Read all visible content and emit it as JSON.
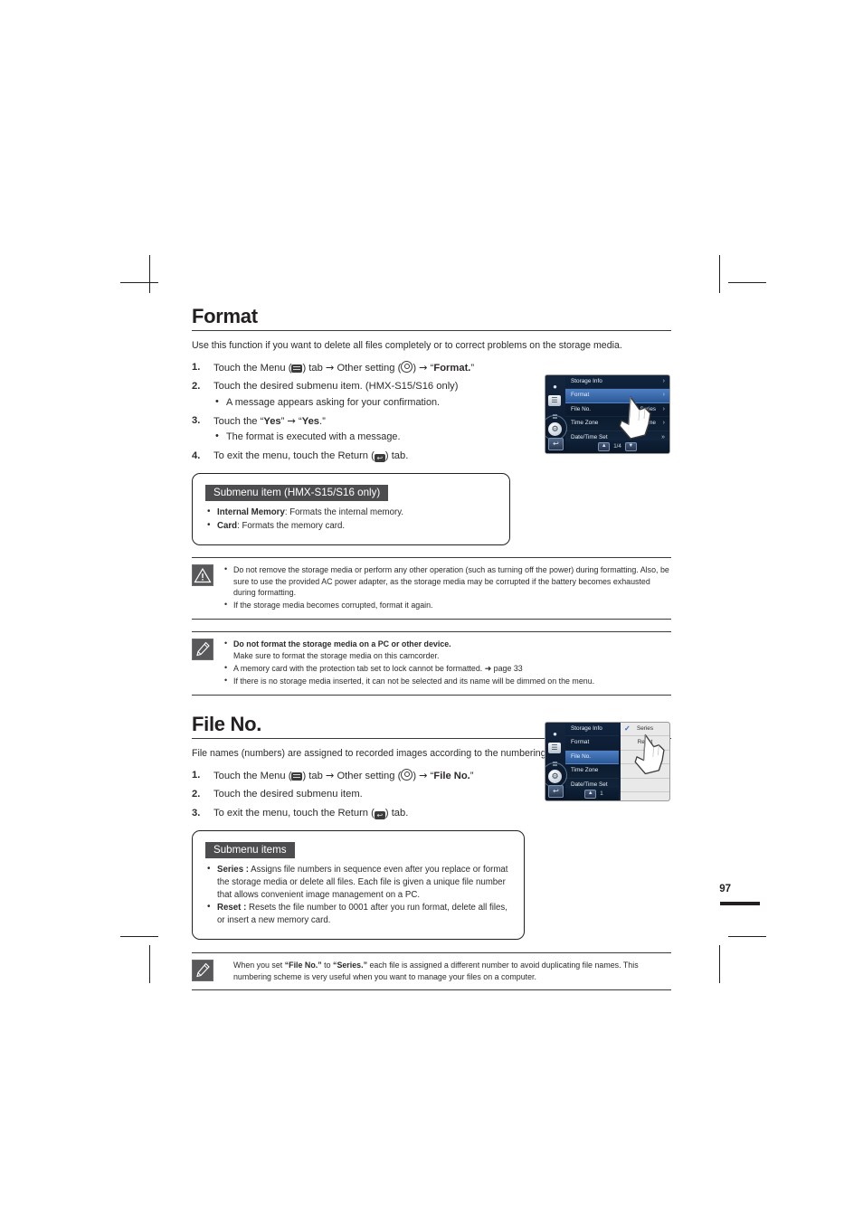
{
  "page": {
    "number": "97"
  },
  "format_section": {
    "title": "Format",
    "lead": "Use this function if you want to delete all files completely or to correct problems on the storage media.",
    "steps": [
      {
        "num": "1.",
        "parts_before": "Touch the Menu (",
        "parts_mid": ") tab",
        "arrow": "→",
        "other_setting": "Other setting (",
        "other_setting_close": ")",
        "target": "Format.",
        "quote_open": "“",
        "quote_close": "”"
      },
      {
        "num": "2.",
        "text": "Touch the desired submenu item. (HMX-S15/S16 only)",
        "bullets": [
          "A message appears asking for your confirmation."
        ]
      },
      {
        "num": "3.",
        "text_pre": "Touch the ",
        "yes1": "Yes",
        "yes2": "Yes",
        "bullets": [
          "The format is executed with a message."
        ]
      },
      {
        "num": "4.",
        "text_pre": "To exit the menu, touch the Return (",
        "text_post": ") tab."
      }
    ],
    "submenu_box": {
      "heading": "Submenu item (HMX-S15/S16 only)",
      "items": [
        {
          "term": "Internal Memory",
          "desc": ": Formats the internal memory."
        },
        {
          "term": "Card",
          "desc": ": Formats the memory card."
        }
      ]
    },
    "warning_note": {
      "icon": "warning-triangle-icon",
      "items": [
        "Do not remove the storage media or perform any other operation (such as turning off the power) during formatting. Also, be sure to use the provided AC power adapter, as the storage media may be corrupted if the battery becomes exhausted during formatting.",
        "If the storage media becomes corrupted, format it again."
      ]
    },
    "info_note": {
      "icon": "note-pen-icon",
      "items": [
        {
          "bold": "Do not format the storage media on a PC or other device.",
          "rest": "Make sure to format the storage media on this camcorder."
        },
        {
          "bold": "",
          "rest": "A memory card with the protection tab set to lock cannot be formatted. ➜ page 33"
        },
        {
          "bold": "",
          "rest": "If there is no storage media inserted, it can not be selected and its name will be dimmed on the menu."
        }
      ]
    }
  },
  "fileno_section": {
    "title": "File No.",
    "lead": "File names (numbers) are assigned to recorded images according to the numbering option you select.",
    "steps": [
      {
        "num": "1.",
        "parts_before": "Touch the Menu (",
        "parts_mid": ") tab",
        "arrow": "→",
        "other_setting": "Other setting (",
        "other_setting_close": ")",
        "target": "File No."
      },
      {
        "num": "2.",
        "text": "Touch the desired submenu item."
      },
      {
        "num": "3.",
        "text_pre": "To exit the menu, touch the Return (",
        "text_post": ") tab."
      }
    ],
    "submenu_box": {
      "heading": "Submenu items",
      "items": [
        {
          "term": "Series :",
          "desc": " Assigns file numbers in sequence even after you replace or format the storage media or delete all files. Each file is given a unique file number that allows convenient image management on a PC."
        },
        {
          "term": "Reset :",
          "desc": " Resets the file number to 0001 after you run format, delete all files, or insert a new memory card."
        }
      ]
    },
    "info_note": {
      "icon": "note-pen-icon",
      "text_1": "When you set ",
      "bold_1": "“File No.”",
      "text_2": " to ",
      "bold_2": "“Series.”",
      "text_3": " each file is assigned a different number to avoid duplicating file names. This numbering scheme is very useful when you want to manage your files on a computer."
    }
  },
  "lcd_format": {
    "rows": [
      {
        "label": "Storage Info",
        "value": "",
        "chev": "›",
        "selected": false
      },
      {
        "label": "Format",
        "value": "",
        "chev": "›",
        "selected": true
      },
      {
        "label": "File No.",
        "value": "Series",
        "chev": "›",
        "selected": false
      },
      {
        "label": "Time Zone",
        "value": "Home",
        "chev": "›",
        "selected": false
      },
      {
        "label": "Date/Time Set",
        "value": "",
        "chev": "»",
        "selected": false
      }
    ],
    "page_indicator": "1/4",
    "rail": {
      "icons": [
        "record-mode-icon",
        "playback-icon",
        "settings-sliders-icon",
        "other-setting-gear-icon"
      ],
      "return": "return-icon"
    }
  },
  "lcd_fileno": {
    "rows": [
      {
        "label": "Storage Info",
        "selected": false
      },
      {
        "label": "Format",
        "selected": false
      },
      {
        "label": "File No.",
        "selected": true
      },
      {
        "label": "Time Zone",
        "selected": false
      },
      {
        "label": "Date/Time Set",
        "selected": false
      }
    ],
    "options": [
      {
        "label": "Series",
        "checked": true
      },
      {
        "label": "Reset",
        "checked": false
      }
    ],
    "page_indicator": "1",
    "rail": {
      "return": "return-icon"
    }
  },
  "colors": {
    "text": "#231f20",
    "heading_rule": "#3a3a3a",
    "badge_bg": "#4d4d4f",
    "lcd_select": "#3a66a8",
    "lcd_check": "#2f66c4"
  }
}
